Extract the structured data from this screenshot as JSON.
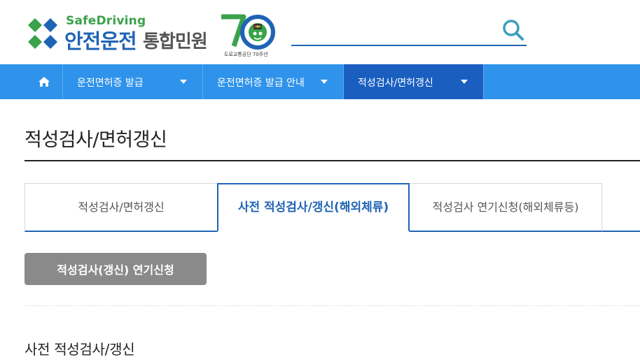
{
  "header": {
    "logo": {
      "sub_text": "SafeDriving",
      "main_text": "안전운전",
      "main_text2": "통합민원",
      "anniversary_caption": "도로교통공단 70주년"
    },
    "search": {
      "value": "",
      "placeholder": ""
    }
  },
  "nav": {
    "items": [
      {
        "label": "운전면허증 발급"
      },
      {
        "label": "운전면허증 발급 안내"
      },
      {
        "label": "적성검사/면허갱신"
      }
    ]
  },
  "page": {
    "title": "적성검사/면허갱신"
  },
  "tabs": [
    {
      "label": "적성검사/면허갱신"
    },
    {
      "label": "사전 적성검사/갱신(해외체류)"
    },
    {
      "label": "적성검사 연기신청(해외체류등)"
    }
  ],
  "action": {
    "label": "적성검사(갱신) 연기신청"
  },
  "section": {
    "title": "사전 적성검사/갱신"
  },
  "colors": {
    "nav_bg": "#2f93eb",
    "nav_active": "#1a5fc0",
    "brand_blue": "#1f64b4",
    "brand_green": "#3aa24a",
    "button_gray": "#8a8a8a"
  }
}
